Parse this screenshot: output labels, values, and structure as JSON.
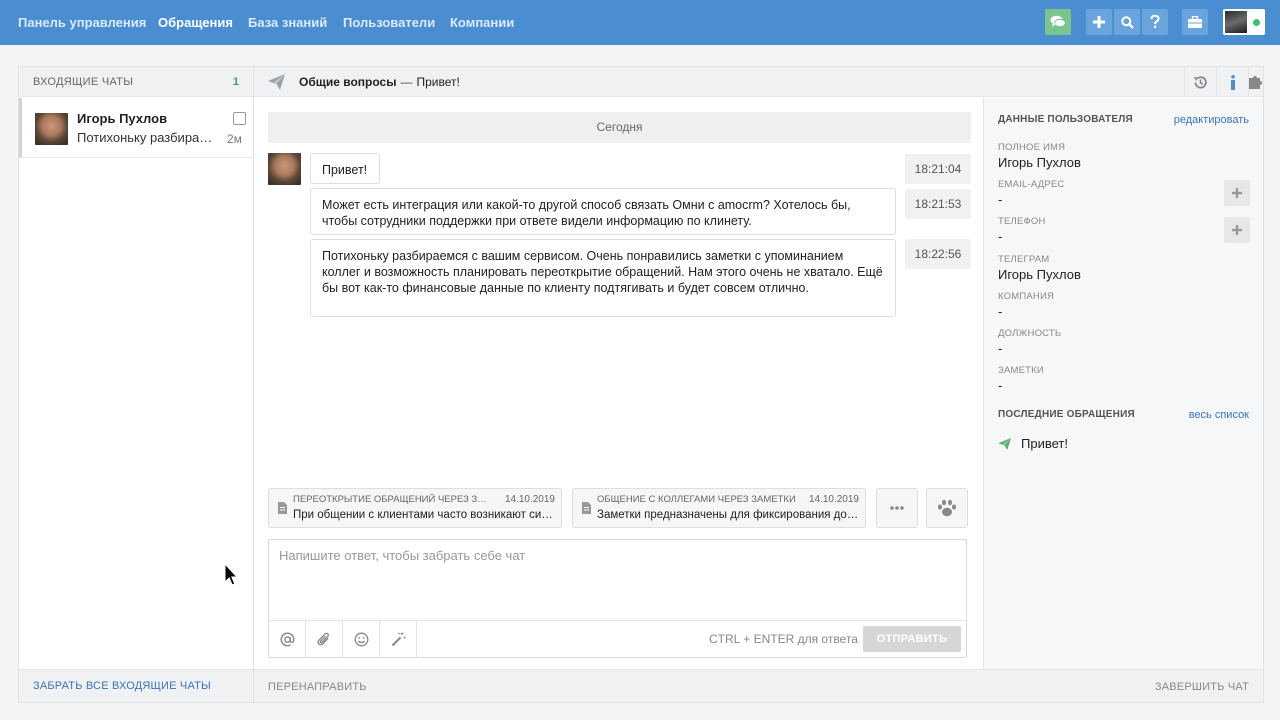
{
  "nav": {
    "items": [
      {
        "label": "Панель управления",
        "active": false
      },
      {
        "label": "Обращения",
        "active": true
      },
      {
        "label": "База знаний",
        "active": false
      },
      {
        "label": "Пользователи",
        "active": false
      },
      {
        "label": "Компании",
        "active": false
      }
    ],
    "icons": [
      "chat-icon",
      "plus-icon",
      "search-icon",
      "help-icon",
      "briefcase-icon"
    ],
    "status_color": "#3cc46a"
  },
  "incoming": {
    "header": "ВХОДЯЩИЕ ЧАТЫ",
    "count": "1",
    "chats": [
      {
        "name": "Игорь Пухлов",
        "preview": "Потихоньку разбирае…",
        "time": "2м"
      }
    ],
    "footer": "ЗАБРАТЬ ВСЕ ВХОДЯЩИЕ ЧАТЫ"
  },
  "conversation": {
    "channel": "Общие вопросы",
    "dash": "—",
    "subject": "Привет!",
    "day_divider": "Сегодня",
    "messages": [
      {
        "text": "Привет!",
        "time": "18:21:04"
      },
      {
        "text": "Может есть интеграция или какой-то другой способ связать Омни с amocrm? Хотелось бы, чтобы сотрудники поддержки при ответе видели информацию по клинету.",
        "time": "18:21:53"
      },
      {
        "text": "Потихоньку разбираемся с вашим сервисом. Очень понравились заметки с упоминанием коллег и возможность планировать переоткрытие обращений. Нам этого очень не хватало. Ещё бы вот как-то финансовые данные по клиенту подтягивать и будет совсем отлично.",
        "time": "18:22:56"
      }
    ],
    "templates": [
      {
        "title": "ПЕРЕОТКРЫТИЕ ОБРАЩЕНИЙ ЧЕРЕЗ ЗА…",
        "date": "14.10.2019",
        "text": "При общении с клиентами часто возникают сит…"
      },
      {
        "title": "ОБЩЕНИЕ С КОЛЛЕГАМИ ЧЕРЕЗ ЗАМЕТКИ",
        "date": "14.10.2019",
        "text": "Заметки предназначены для фиксирования до…"
      }
    ],
    "composer": {
      "placeholder": "Напишите ответ, чтобы забрать себе чат",
      "hint": "CTRL + ENTER для ответа",
      "send": "ОТПРАВИТЬ"
    },
    "footer_left": "ПЕРЕНАПРАВИТЬ",
    "footer_right": "ЗАВЕРШИТЬ ЧАТ"
  },
  "user_panel": {
    "title": "ДАННЫЕ ПОЛЬЗОВАТЕЛЯ",
    "edit": "редактировать",
    "fields": [
      {
        "label": "ПОЛНОЕ ИМЯ",
        "value": "Игорь Пухлов"
      },
      {
        "label": "EMAIL-АДРЕС",
        "value": "-"
      },
      {
        "label": "ТЕЛЕФОН",
        "value": "-"
      },
      {
        "label": "ТЕЛЕГРАМ",
        "value": "Игорь Пухлов"
      },
      {
        "label": "КОМПАНИЯ",
        "value": "-"
      },
      {
        "label": "ДОЛЖНОСТЬ",
        "value": "-"
      },
      {
        "label": "ЗАМЕТКИ",
        "value": "-"
      }
    ],
    "recent_title": "ПОСЛЕДНИЕ ОБРАЩЕНИЯ",
    "recent_link": "весь список",
    "recent": [
      {
        "subject": "Привет!"
      }
    ]
  }
}
